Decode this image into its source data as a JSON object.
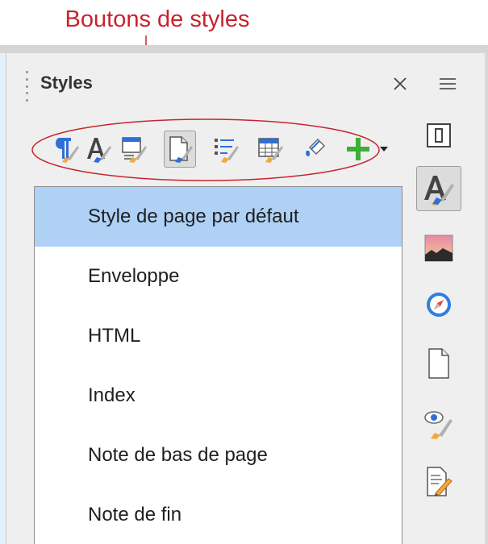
{
  "annotation": {
    "label": "Boutons de styles",
    "color": "#c8232c"
  },
  "panel": {
    "title": "Styles",
    "close_icon": "close-icon",
    "menu_icon": "hamburger-menu-icon"
  },
  "style_categories": [
    {
      "icon": "paragraph-styles-icon",
      "active": false
    },
    {
      "icon": "character-styles-icon",
      "active": false
    },
    {
      "icon": "frame-styles-icon",
      "active": false
    },
    {
      "icon": "page-styles-icon",
      "active": true
    },
    {
      "icon": "list-styles-icon",
      "active": false
    },
    {
      "icon": "table-styles-icon",
      "active": false
    },
    {
      "icon": "fill-format-mode-icon",
      "active": false
    },
    {
      "icon": "new-style-icon",
      "active": false
    },
    {
      "icon": "dropdown-arrow-icon",
      "active": false
    }
  ],
  "styles_list": {
    "items": [
      "Style de page par défaut",
      "Enveloppe",
      "HTML",
      "Index",
      "Note de bas de page",
      "Note de fin"
    ],
    "selected_index": 0
  },
  "sidebar": [
    {
      "icon": "properties-icon",
      "active": false
    },
    {
      "icon": "styles-icon",
      "active": true
    },
    {
      "icon": "gallery-icon",
      "active": false
    },
    {
      "icon": "navigator-icon",
      "active": false
    },
    {
      "icon": "page-icon",
      "active": false
    },
    {
      "icon": "style-inspector-icon",
      "active": false
    },
    {
      "icon": "manage-changes-icon",
      "active": false
    }
  ],
  "colors": {
    "selection": "#aed1f5",
    "accent_green": "#3cb034",
    "accent_blue": "#2f6fd6",
    "brush_orange": "#f2a93b"
  }
}
